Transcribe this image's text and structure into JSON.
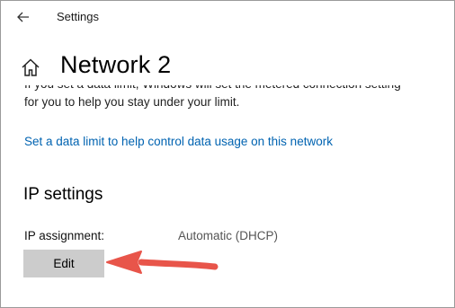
{
  "window": {
    "title": "Settings"
  },
  "page": {
    "title": "Network 2"
  },
  "data_limit": {
    "description_line1": "If you set a data limit, Windows will set the metered connection setting",
    "description_line2": "for you to help you stay under your limit.",
    "link_text": "Set a data limit to help control data usage on this network"
  },
  "ip_settings": {
    "heading": "IP settings",
    "assignment_label": "IP assignment:",
    "assignment_value": "Automatic (DHCP)",
    "edit_label": "Edit"
  },
  "icons": {
    "back": "back-arrow-icon",
    "home": "home-icon",
    "annotation": "red-arrow-annotation"
  },
  "colors": {
    "link": "#0063b1",
    "button_bg": "#cccccc",
    "annotation_arrow": "#e8554a"
  }
}
